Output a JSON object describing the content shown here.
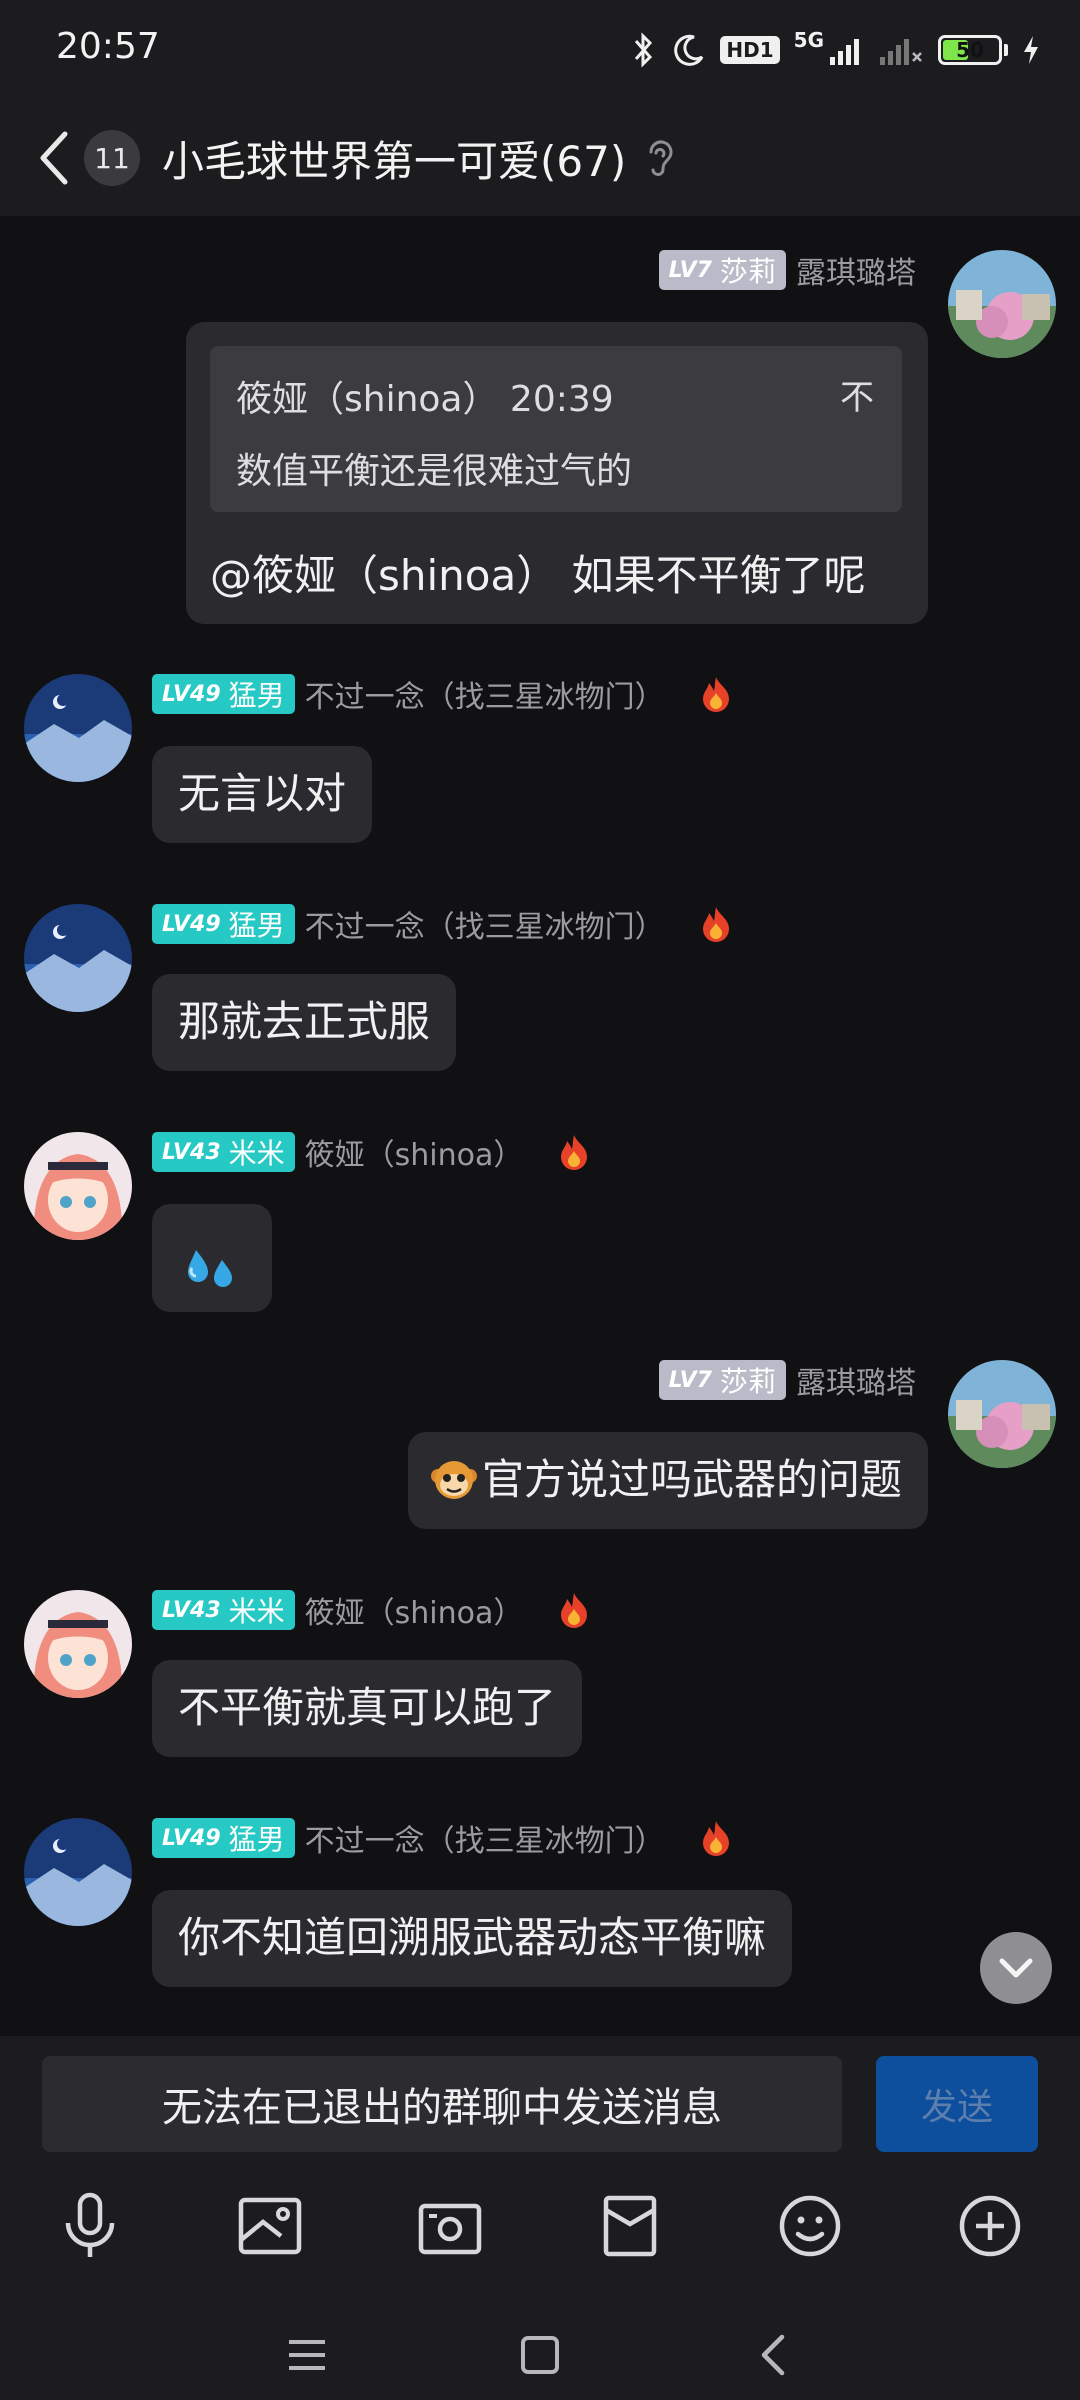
{
  "status_bar": {
    "time": "20:57",
    "hd_label": "HD1",
    "network_label": "5G",
    "battery_percent": "50",
    "battery_level": 0.5,
    "icons": [
      "bluetooth-icon",
      "moon-icon",
      "signal-icon",
      "signal-weak-icon",
      "charging-icon"
    ]
  },
  "header": {
    "unread_count": "11",
    "title": "小毛球世界第一可爱(67)"
  },
  "messages": [
    {
      "side": "right",
      "badge_level": "LV7",
      "badge_title": "莎莉",
      "nickname": "露琪璐塔",
      "quote_author_time": "筱娅（shinoa）  20:39",
      "quote_flag": "不",
      "quote_text": "数值平衡还是很难过气的",
      "text": "@筱娅（shinoa） 如果不平衡了呢"
    },
    {
      "side": "left",
      "badge_level": "LV49",
      "badge_title": "猛男",
      "nickname": "不过一念（找三星冰物门）",
      "text": "无言以对"
    },
    {
      "side": "left",
      "badge_level": "LV49",
      "badge_title": "猛男",
      "nickname": "不过一念（找三星冰物门）",
      "text": "那就去正式服"
    },
    {
      "side": "left",
      "badge_level": "LV43",
      "badge_title": "米米",
      "nickname": "筱娅（shinoa）",
      "text": "💦"
    },
    {
      "side": "right",
      "badge_level": "LV7",
      "badge_title": "莎莉",
      "nickname": "露琪璐塔",
      "text": "官方说过吗武器的问题"
    },
    {
      "side": "left",
      "badge_level": "LV43",
      "badge_title": "米米",
      "nickname": "筱娅（shinoa）",
      "text": "不平衡就真可以跑了"
    },
    {
      "side": "left",
      "badge_level": "LV49",
      "badge_title": "猛男",
      "nickname": "不过一念（找三星冰物门）",
      "text": "你不知道回溯服武器动态平衡嘛"
    }
  ],
  "input_bar": {
    "disabled_text": "无法在已退出的群聊中发送消息",
    "send_label": "发送"
  },
  "colors": {
    "background": "#111113",
    "bubble": "#2b2b2f",
    "badge_teal": "#27c9c4",
    "badge_gray": "#b9bcc8",
    "send_button": "#0d4f9c"
  }
}
